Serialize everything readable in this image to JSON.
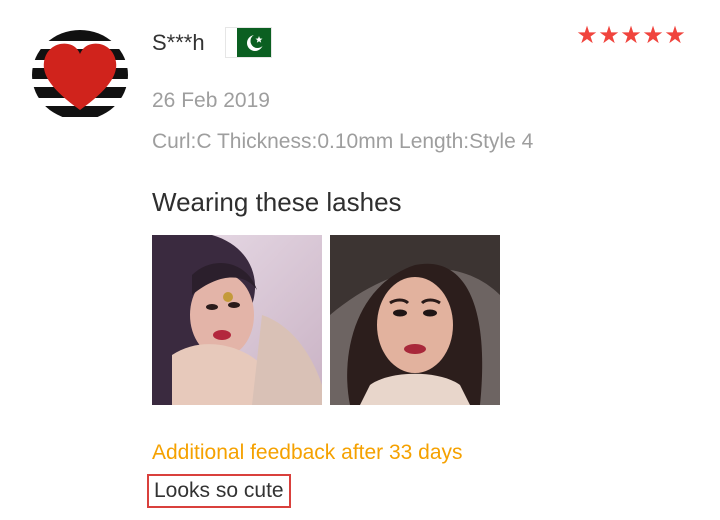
{
  "review": {
    "username": "S***h",
    "country_flag": "pakistan-flag-icon",
    "rating": 5,
    "stars": [
      "★",
      "★",
      "★",
      "★",
      "★"
    ],
    "date": "26 Feb 2019",
    "sku": "Curl:C Thickness:0.10mm Length:Style 4",
    "text": "Wearing these lashes",
    "photos": [
      "review-photo-1",
      "review-photo-2"
    ],
    "additional_feedback_label": "Additional feedback after 33 days",
    "additional_feedback_text": "Looks so cute"
  },
  "colors": {
    "star": "#f0443d",
    "feedback_label": "#f5a100",
    "highlight_border": "#d9403c",
    "meta_text": "#9e9e9e"
  }
}
